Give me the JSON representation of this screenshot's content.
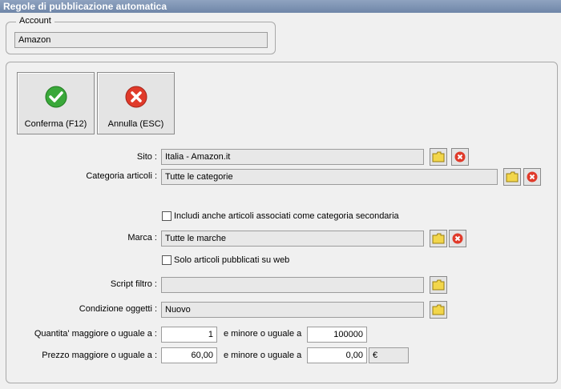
{
  "window": {
    "title": "Regole di pubblicazione automatica"
  },
  "account": {
    "legend": "Account",
    "value": "Amazon"
  },
  "buttons": {
    "confirm": "Conferma (F12)",
    "cancel": "Annulla (ESC)"
  },
  "sito": {
    "label": "Sito :",
    "value": "Italia - Amazon.it"
  },
  "categoria": {
    "label": "Categoria articoli :",
    "value": "Tutte le categorie"
  },
  "includi": {
    "label": "Includi anche articoli associati come categoria secondaria",
    "checked": false
  },
  "marca": {
    "label": "Marca :",
    "value": "Tutte le marche"
  },
  "solo_web": {
    "label": "Solo articoli pubblicati su web",
    "checked": false
  },
  "script": {
    "label": "Script filtro :",
    "value": ""
  },
  "condizione": {
    "label": "Condizione oggetti :",
    "value": "Nuovo"
  },
  "quantita": {
    "label": "Quantita' maggiore o uguale a :",
    "min": "1",
    "max_label": "e minore o uguale a",
    "max": "100000"
  },
  "prezzo": {
    "label": "Prezzo maggiore o uguale a :",
    "min": "60,00",
    "max_label": "e minore o uguale a",
    "max": "0,00",
    "currency": "€"
  },
  "colors": {
    "confirm": "#3aa83a",
    "cancel": "#e03a2a",
    "folder": "#f2d64b"
  }
}
